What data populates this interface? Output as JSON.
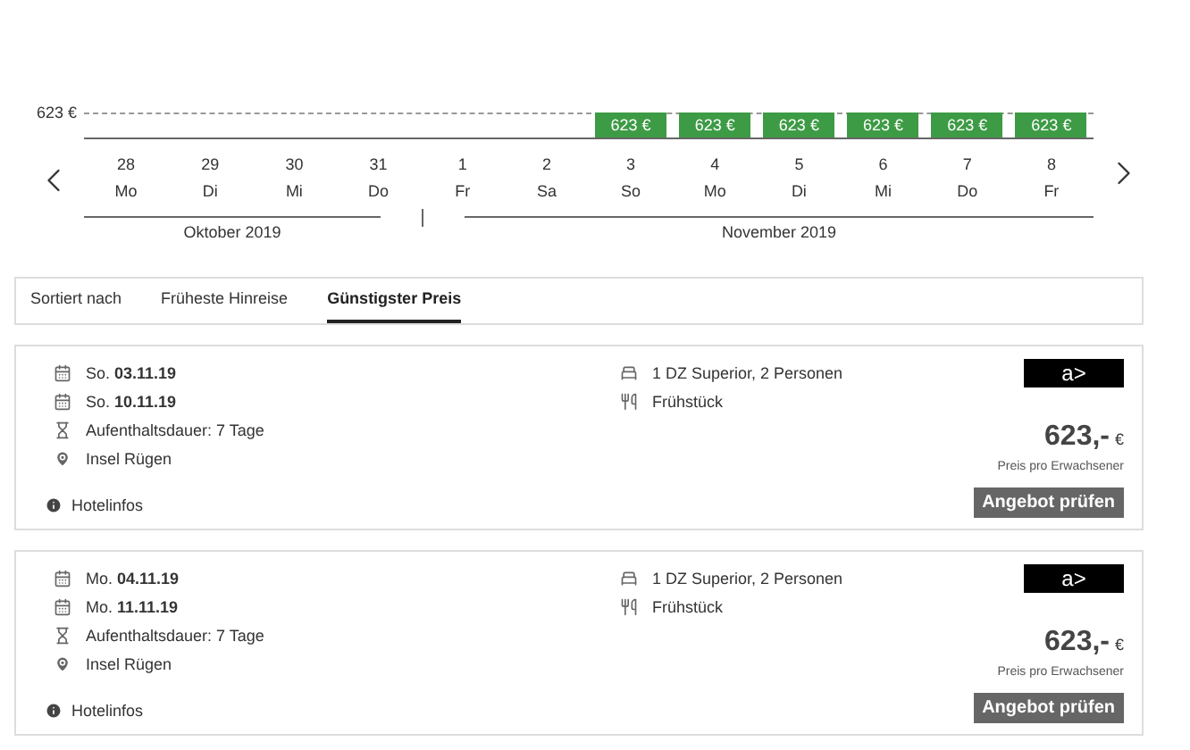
{
  "price_axis_label": "623 €",
  "days": [
    {
      "day": "28",
      "weekday": "Mo"
    },
    {
      "day": "29",
      "weekday": "Di"
    },
    {
      "day": "30",
      "weekday": "Mi"
    },
    {
      "day": "31",
      "weekday": "Do"
    },
    {
      "day": "1",
      "weekday": "Fr"
    },
    {
      "day": "2",
      "weekday": "Sa"
    },
    {
      "day": "3",
      "weekday": "So",
      "price": "623 €"
    },
    {
      "day": "4",
      "weekday": "Mo",
      "price": "623 €"
    },
    {
      "day": "5",
      "weekday": "Di",
      "price": "623 €"
    },
    {
      "day": "6",
      "weekday": "Mi",
      "price": "623 €"
    },
    {
      "day": "7",
      "weekday": "Do",
      "price": "623 €"
    },
    {
      "day": "8",
      "weekday": "Fr",
      "price": "623 €"
    }
  ],
  "months": [
    "Oktober 2019",
    "November 2019"
  ],
  "sort": {
    "label": "Sortiert nach",
    "options": [
      {
        "label": "Früheste Hinreise",
        "selected": false
      },
      {
        "label": "Günstigster Preis",
        "selected": true
      }
    ]
  },
  "offers": [
    {
      "departure": "So. **03.11.19**",
      "return": "So. **10.11.19**",
      "duration": "Aufenthaltsdauer: 7 Tage",
      "location": "Insel Rügen",
      "room": "1 DZ Superior, 2 Personen",
      "board": "Frühstück",
      "logo": "a>",
      "price": "623,-",
      "currency": "€",
      "price_note": "Preis pro Erwachsener",
      "button": "Angebot prüfen",
      "info": "Hotelinfos"
    },
    {
      "departure": "Mo. **04.11.19**",
      "return": "Mo. **11.11.19**",
      "duration": "Aufenthaltsdauer: 7 Tage",
      "location": "Insel Rügen",
      "room": "1 DZ Superior, 2 Personen",
      "board": "Frühstück",
      "logo": "a>",
      "price": "623,-",
      "currency": "€",
      "price_note": "Preis pro Erwachsener",
      "button": "Angebot prüfen",
      "info": "Hotelinfos"
    }
  ]
}
